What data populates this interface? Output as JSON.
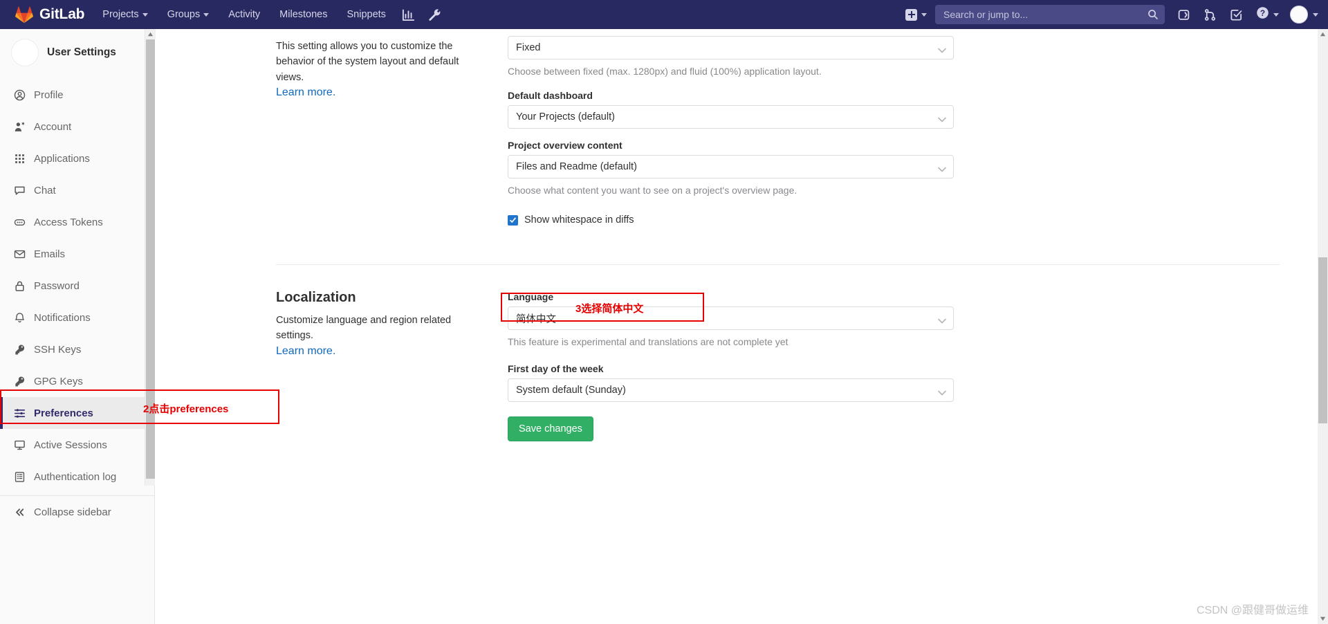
{
  "navbar": {
    "brand": "GitLab",
    "logo_icon": "gitlab-tanuki-icon",
    "links": [
      {
        "label": "Projects",
        "has_caret": true,
        "icon": "chevron-down-icon"
      },
      {
        "label": "Groups",
        "has_caret": true,
        "icon": "chevron-down-icon"
      },
      {
        "label": "Activity",
        "has_caret": false,
        "icon": ""
      },
      {
        "label": "Milestones",
        "has_caret": false,
        "icon": ""
      },
      {
        "label": "Snippets",
        "has_caret": false,
        "icon": ""
      }
    ],
    "icon_buttons": [
      {
        "name": "analytics-chart-icon",
        "title": "Analytics"
      },
      {
        "name": "wrench-icon",
        "title": "Admin Area"
      }
    ],
    "create_new": {
      "icon": "plus-square-icon",
      "caret": "chevron-down-icon"
    },
    "search": {
      "placeholder": "Search or jump to...",
      "value": "",
      "icon": "search-icon"
    },
    "right_icons": [
      {
        "name": "issues-icon",
        "title": "Issues"
      },
      {
        "name": "merge-request-icon",
        "title": "Merge requests"
      },
      {
        "name": "todos-check-icon",
        "title": "To-Do List"
      }
    ],
    "help": {
      "icon": "help-question-icon",
      "caret": "chevron-down-icon"
    },
    "user": {
      "icon": "avatar",
      "caret": "chevron-down-icon"
    }
  },
  "sidebar": {
    "title": "User Settings",
    "avatar_icon": "user-avatar",
    "items": [
      {
        "label": "Profile",
        "icon": "user-circle-icon",
        "active": false
      },
      {
        "label": "Account",
        "icon": "user-gear-icon",
        "active": false
      },
      {
        "label": "Applications",
        "icon": "grid-dots-icon",
        "active": false
      },
      {
        "label": "Chat",
        "icon": "comment-icon",
        "active": false
      },
      {
        "label": "Access Tokens",
        "icon": "token-icon",
        "active": false
      },
      {
        "label": "Emails",
        "icon": "envelope-icon",
        "active": false
      },
      {
        "label": "Password",
        "icon": "lock-icon",
        "active": false
      },
      {
        "label": "Notifications",
        "icon": "bell-icon",
        "active": false
      },
      {
        "label": "SSH Keys",
        "icon": "key-icon",
        "active": false
      },
      {
        "label": "GPG Keys",
        "icon": "key-icon",
        "active": false
      },
      {
        "label": "Preferences",
        "icon": "sliders-icon",
        "active": true
      },
      {
        "label": "Active Sessions",
        "icon": "monitor-icon",
        "active": false
      },
      {
        "label": "Authentication log",
        "icon": "log-list-icon",
        "active": false
      }
    ],
    "collapse": {
      "label": "Collapse sidebar",
      "icon": "chevrons-left-icon"
    }
  },
  "behavior_section": {
    "description": "This setting allows you to customize the behavior of the system layout and default views.",
    "learn_more": "Learn more.",
    "layout": {
      "value": "Fixed",
      "help": "Choose between fixed (max. 1280px) and fluid (100%) application layout."
    },
    "default_dashboard": {
      "label": "Default dashboard",
      "value": "Your Projects (default)"
    },
    "project_overview": {
      "label": "Project overview content",
      "value": "Files and Readme (default)",
      "help": "Choose what content you want to see on a project's overview page."
    },
    "whitespace": {
      "label": "Show whitespace in diffs",
      "checked": true
    }
  },
  "localization_section": {
    "title": "Localization",
    "description": "Customize language and region related settings.",
    "learn_more": "Learn more.",
    "language": {
      "label": "Language",
      "value": "简体中文",
      "help": "This feature is experimental and translations are not complete yet"
    },
    "first_day": {
      "label": "First day of the week",
      "value": "System default (Sunday)"
    },
    "save_label": "Save changes"
  },
  "annotations": [
    {
      "id": "preferences",
      "text": "2点击preferences",
      "color": "#e60000"
    },
    {
      "id": "language",
      "text": "3选择简体中文",
      "color": "#e60000"
    }
  ],
  "watermark": "CSDN @跟健哥做运维",
  "colors": {
    "navbar_bg": "#292961",
    "accent": "#1068bf",
    "save_green": "#31af64",
    "annotation_red": "#e60000",
    "checkbox_blue": "#1f75cb"
  }
}
